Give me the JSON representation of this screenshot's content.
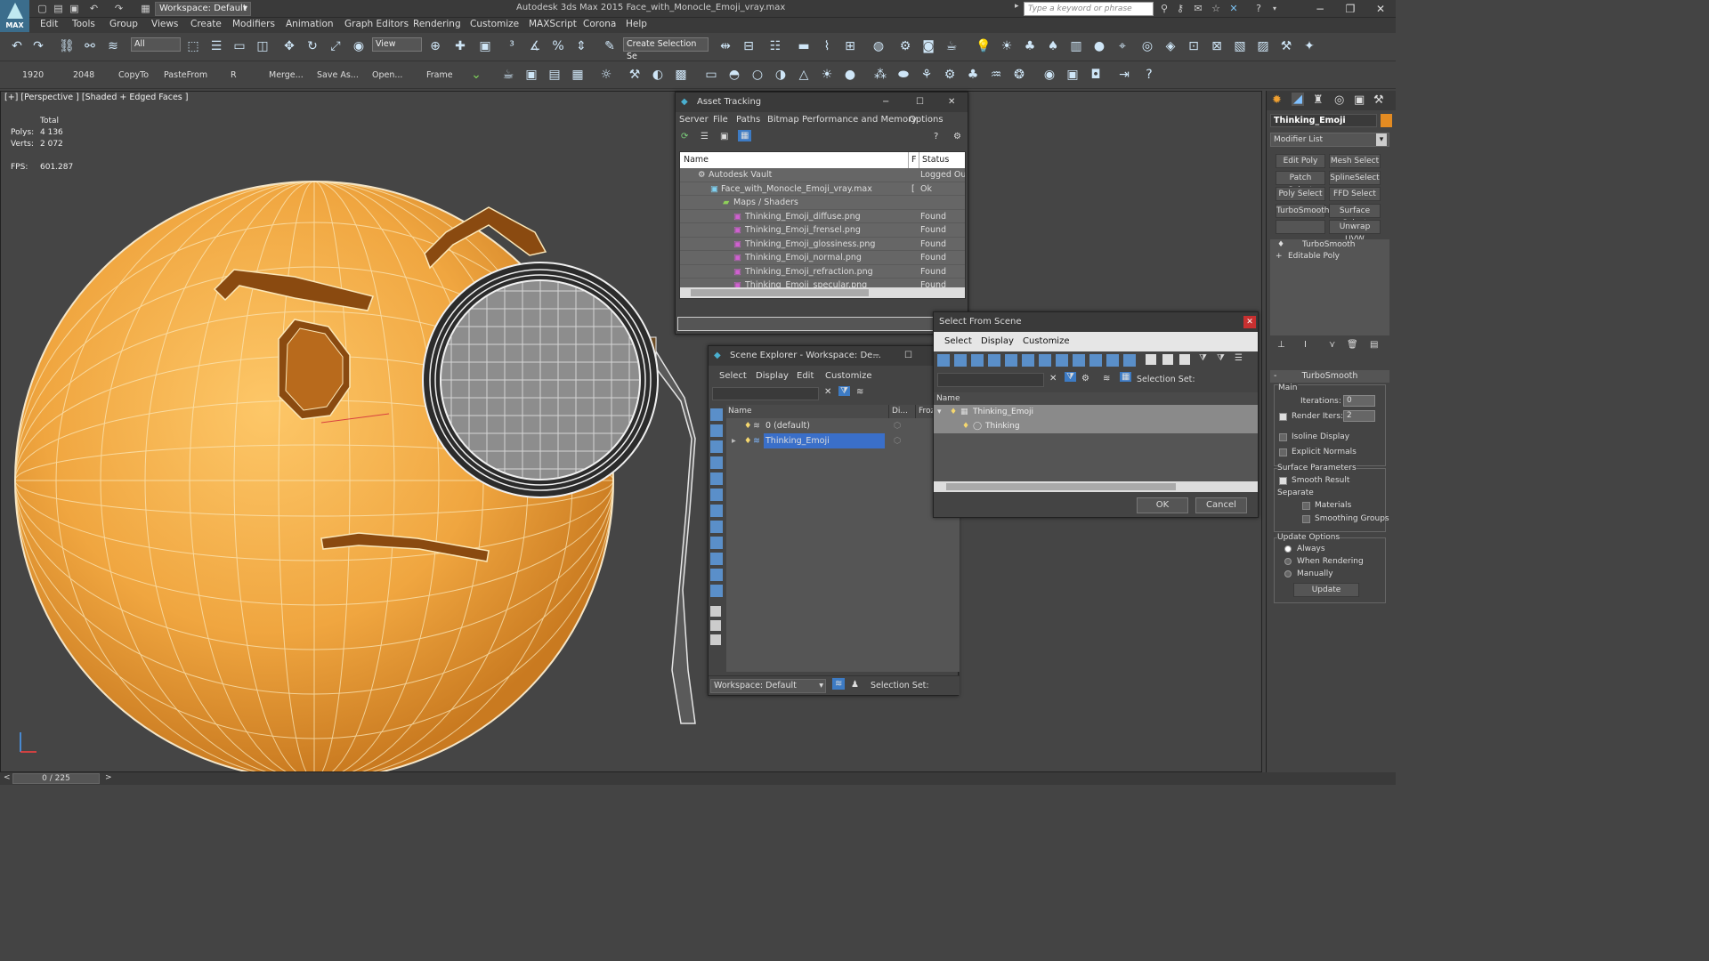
{
  "app": {
    "logo": "MAX",
    "title": "Autodesk 3ds Max  2015    Face_with_Monocle_Emoji_vray.max",
    "workspace": "Workspace: Default",
    "search_placeholder": "Type a keyword or phrase"
  },
  "menu": [
    "Edit",
    "Tools",
    "Group",
    "Views",
    "Create",
    "Modifiers",
    "Animation",
    "Graph Editors",
    "Rendering",
    "Customize",
    "MAXScript",
    "Corona",
    "Help"
  ],
  "toolbar": {
    "filter": "All",
    "view": "View",
    "selection_set": "Create Selection Se"
  },
  "toolbar2": [
    "1920",
    "2048",
    "CopyTo",
    "PasteFrom",
    "R",
    "Merge...",
    "Save As...",
    "Open...",
    "Frame"
  ],
  "viewport": {
    "label": "[+] [Perspective ] [Shaded + Edged Faces ]",
    "total": "Total",
    "polys_label": "Polys:",
    "polys": "4 136",
    "verts_label": "Verts:",
    "verts": "2 072",
    "fps_label": "FPS:",
    "fps": "601.287"
  },
  "asset_tracking": {
    "title": "Asset Tracking",
    "menu": [
      "Server",
      "File",
      "Paths",
      "Bitmap Performance and Memory",
      "Options"
    ],
    "col_name": "Name",
    "col_f": "F",
    "col_status": "Status",
    "rows": [
      {
        "name": "Autodesk Vault",
        "f": "",
        "status": "Logged Out"
      },
      {
        "name": "Face_with_Monocle_Emoji_vray.max",
        "f": "[",
        "status": "Ok"
      },
      {
        "name": "Maps / Shaders",
        "f": "",
        "status": ""
      },
      {
        "name": "Thinking_Emoji_diffuse.png",
        "f": "",
        "status": "Found"
      },
      {
        "name": "Thinking_Emoji_frensel.png",
        "f": "",
        "status": "Found"
      },
      {
        "name": "Thinking_Emoji_glossiness.png",
        "f": "",
        "status": "Found"
      },
      {
        "name": "Thinking_Emoji_normal.png",
        "f": "",
        "status": "Found"
      },
      {
        "name": "Thinking_Emoji_refraction.png",
        "f": "",
        "status": "Found"
      },
      {
        "name": "Thinking_Emoji_specular.png",
        "f": "",
        "status": "Found"
      }
    ]
  },
  "scene_explorer": {
    "title": "Scene Explorer - Workspace: De...",
    "menu": [
      "Select",
      "Display",
      "Edit",
      "Customize"
    ],
    "col_name": "Name",
    "col_di": "Di...",
    "col_frozen": "Frozen",
    "rows": [
      "0 (default)",
      "Thinking_Emoji"
    ],
    "footer_workspace": "Workspace: Default",
    "footer_selset": "Selection Set:"
  },
  "select_from_scene": {
    "title": "Select From Scene",
    "menu": [
      "Select",
      "Display",
      "Customize"
    ],
    "selset": "Selection Set:",
    "col_name": "Name",
    "rows": [
      "Thinking_Emoji",
      "Thinking"
    ],
    "ok": "OK",
    "cancel": "Cancel"
  },
  "command_panel": {
    "object_name": "Thinking_Emoji",
    "modifier_list": "Modifier List",
    "buttons": [
      "Edit Poly",
      "Mesh Select",
      "Patch Select",
      "SplineSelect",
      "Poly Select",
      "FFD Select",
      "TurboSmooth",
      "Surface Select",
      "",
      "Unwrap UVW"
    ],
    "stack": [
      "TurboSmooth",
      "Editable Poly"
    ],
    "rollout": "TurboSmooth",
    "main": "Main",
    "iterations_label": "Iterations:",
    "iterations": "0",
    "render_iters_label": "Render Iters:",
    "render_iters": "2",
    "isoline": "Isoline Display",
    "explicit": "Explicit Normals",
    "surface_params": "Surface Parameters",
    "smooth_result": "Smooth Result",
    "separate": "Separate",
    "materials": "Materials",
    "smoothing_groups": "Smoothing Groups",
    "update_options": "Update Options",
    "always": "Always",
    "when_rendering": "When Rendering",
    "manually": "Manually",
    "update": "Update"
  },
  "status": {
    "frame": "0 / 225"
  }
}
